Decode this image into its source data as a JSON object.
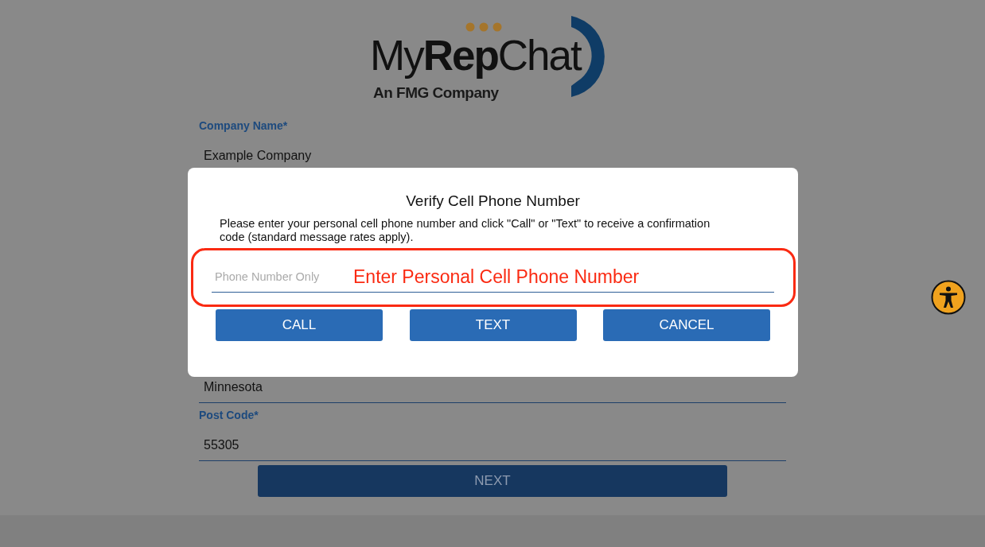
{
  "logo": {
    "wordmark": "My**Rep**Chat",
    "tagline": "An FMG Company"
  },
  "form": {
    "fields_above_dialog": [
      {
        "label": "Company Name*",
        "value": "Example Company"
      }
    ],
    "fields_below_dialog": [
      {
        "value": "Minnesota"
      },
      {
        "label": "Post Code*",
        "value": "55305"
      }
    ],
    "next_button": {
      "label": "NEXT",
      "disabled": true
    }
  },
  "dialog": {
    "title": "Verify Cell Phone Number",
    "message": "Please enter your personal cell phone number and click \"Call\" or \"Text\" to receive a confirmation code (standard message rates apply).",
    "phone_field": {
      "placeholder": "Phone Number Only"
    },
    "annotation": "Enter Personal Cell Phone Number",
    "buttons": [
      "CALL",
      "TEXT",
      "CANCEL"
    ]
  }
}
